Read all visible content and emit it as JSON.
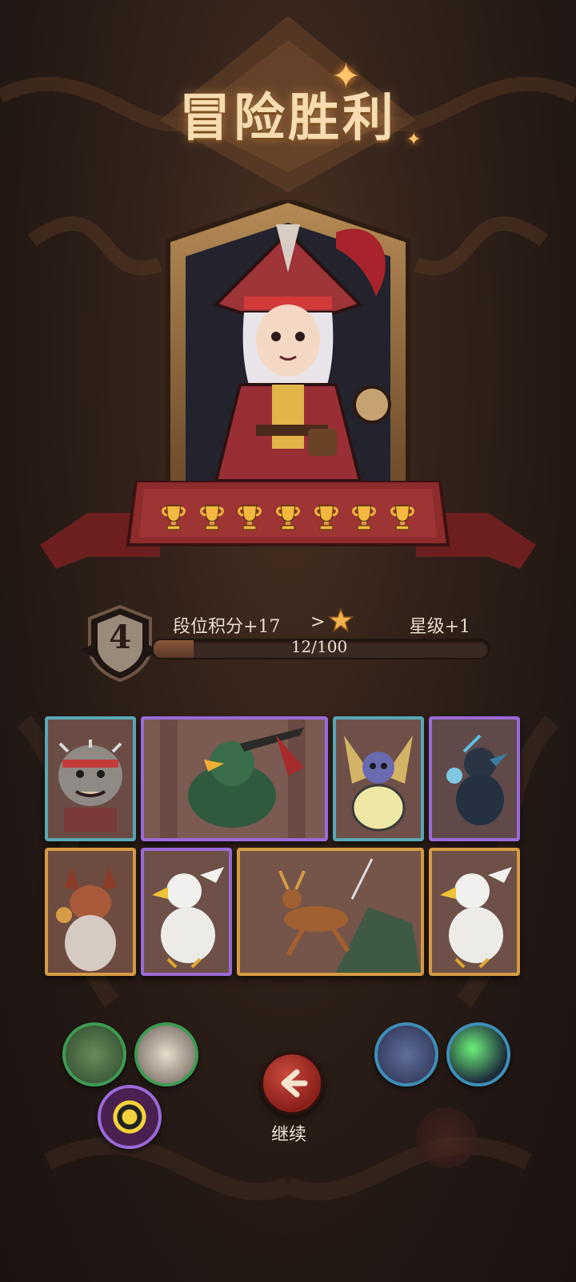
{
  "title": "冒险胜利",
  "rank": {
    "number": "4",
    "points_text": "段位积分+17",
    "arrow": ">",
    "star_text": "星级+1",
    "progress_text": "12/100",
    "progress_fraction": 0.12
  },
  "trophies_count": 7,
  "cards": [
    {
      "name": "spiked-boar-card",
      "rarity": "blue"
    },
    {
      "name": "green-parrot-card",
      "rarity": "purple"
    },
    {
      "name": "bee-bug-card",
      "rarity": "blue"
    },
    {
      "name": "crow-shadow-card",
      "rarity": "purple"
    },
    {
      "name": "fox-card",
      "rarity": "gold"
    },
    {
      "name": "eagle-card",
      "rarity": "purple"
    },
    {
      "name": "deer-card",
      "rarity": "gold"
    },
    {
      "name": "eagle-card-2",
      "rarity": "gold"
    }
  ],
  "continue_label": "继续",
  "colors": {
    "accent_red": "#a8322a",
    "gold": "#d59b45",
    "purple": "#9b6ad8",
    "blue": "#5aa7b4"
  }
}
